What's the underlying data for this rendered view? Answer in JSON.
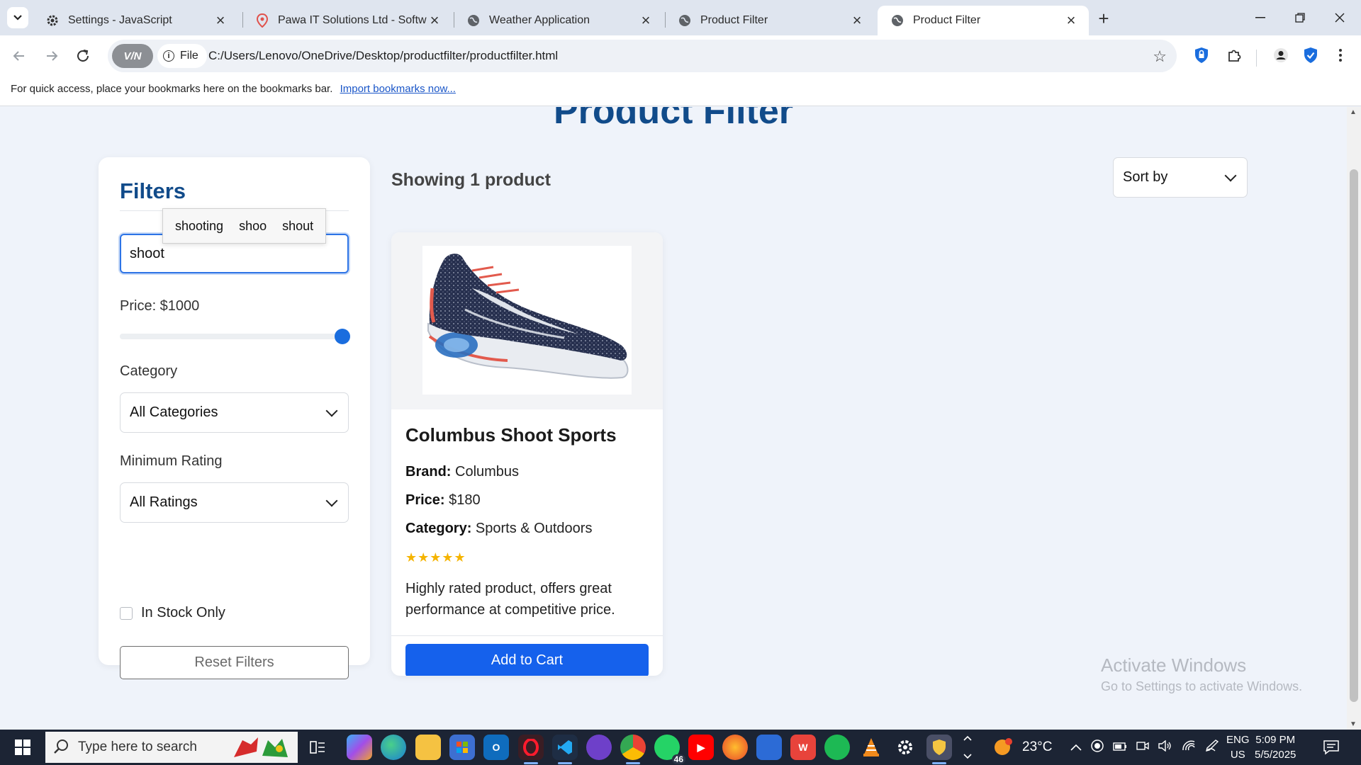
{
  "browser": {
    "tabs": [
      {
        "title": "Settings - JavaScript",
        "icon": "gear-icon"
      },
      {
        "title": "Pawa IT Solutions Ltd - Software",
        "icon": "pin-icon"
      },
      {
        "title": "Weather Application",
        "icon": "globe-icon"
      },
      {
        "title": "Product Filter",
        "icon": "globe-icon"
      },
      {
        "title": "Product Filter",
        "icon": "globe-icon",
        "active": true
      }
    ],
    "vpn_label": "V/N",
    "file_chip": "File",
    "url": "C:/Users/Lenovo/OneDrive/Desktop/productfilter/productfilter.html",
    "bookmarks_text": "For quick access, place your bookmarks here on the bookmarks bar.",
    "bookmarks_link": "Import bookmarks now..."
  },
  "page": {
    "title": "Product Filter",
    "filters": {
      "heading": "Filters",
      "search_value": "shoot",
      "suggestions": [
        "shooting",
        "shoo",
        "shout"
      ],
      "price_label": "Price: $1000",
      "price_slider_fraction": 1.0,
      "category_label": "Category",
      "category_value": "All Categories",
      "rating_label": "Minimum Rating",
      "rating_value": "All Ratings",
      "in_stock_label": "In Stock Only",
      "in_stock_checked": false,
      "reset_label": "Reset Filters"
    },
    "results": {
      "showing_text": "Showing 1 product",
      "sort_label": "Sort by"
    },
    "product": {
      "name": "Columbus Shoot Sports",
      "brand_label": "Brand:",
      "brand": "Columbus",
      "price_label": "Price:",
      "price": "$180",
      "category_label": "Category:",
      "category": "Sports & Outdoors",
      "stars": "★★★★★",
      "rating": 5,
      "description": "Highly rated product, offers great performance at competitive price.",
      "add_to_cart": "Add to Cart"
    },
    "watermark": {
      "line1": "Activate Windows",
      "line2": "Go to Settings to activate Windows."
    }
  },
  "taskbar": {
    "search_placeholder": "Type here to search",
    "temperature": "23°C",
    "lang1": "ENG",
    "lang2": "US",
    "time": "5:09 PM",
    "date": "5/5/2025",
    "whatsapp_badge": "46",
    "accent": "#1561ec",
    "title_color": "#114b8a"
  }
}
